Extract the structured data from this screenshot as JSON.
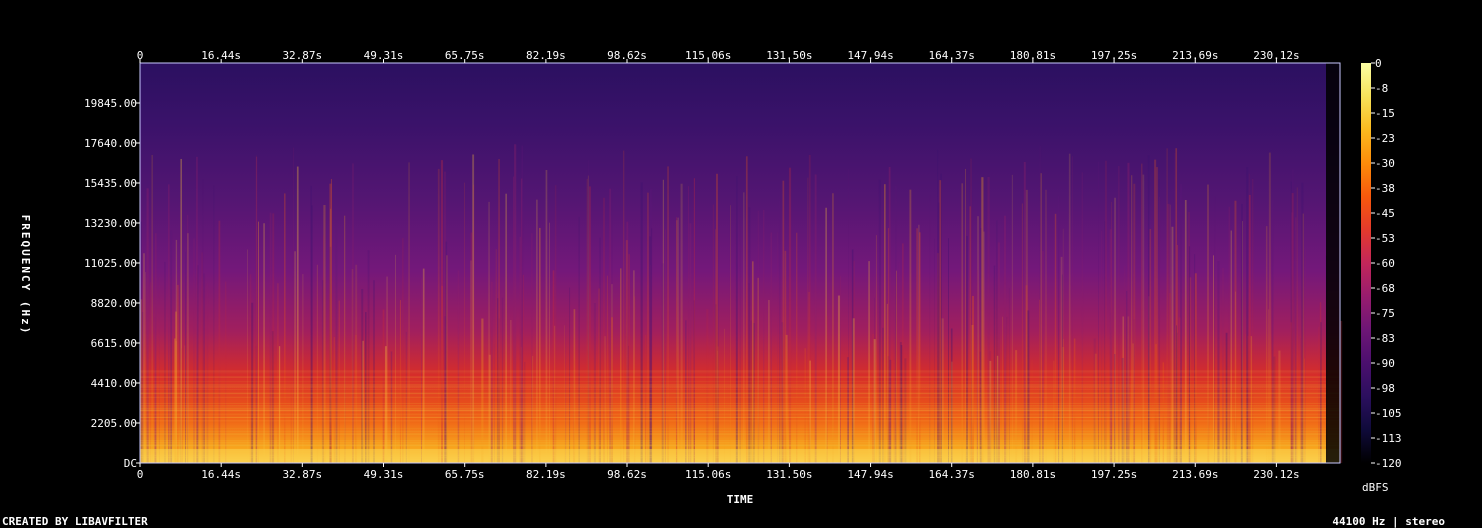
{
  "chart_data": {
    "type": "heatmap",
    "xlabel": "TIME",
    "ylabel": "FREQUENCY (Hz)",
    "x_ticks": [
      "0",
      "16.44s",
      "32.87s",
      "49.31s",
      "65.75s",
      "82.19s",
      "98.62s",
      "115.06s",
      "131.50s",
      "147.94s",
      "164.37s",
      "180.81s",
      "197.25s",
      "213.69s",
      "230.12s"
    ],
    "x_tick_values": [
      0,
      16.44,
      32.87,
      49.31,
      65.75,
      82.19,
      98.62,
      115.06,
      131.5,
      147.94,
      164.37,
      180.81,
      197.25,
      213.69,
      230.12
    ],
    "xlim": [
      0,
      243
    ],
    "y_ticks": [
      "DC",
      "2205.00",
      "4410.00",
      "6615.00",
      "8820.00",
      "11025.00",
      "13230.00",
      "15435.00",
      "17640.00",
      "19845.00"
    ],
    "y_tick_values": [
      0,
      2205,
      4410,
      6615,
      8820,
      11025,
      13230,
      15435,
      17640,
      19845
    ],
    "ylim": [
      0,
      22050
    ],
    "colorbar": {
      "label": "dBFS",
      "ticks": [
        "0",
        "-8",
        "-15",
        "-23",
        "-30",
        "-38",
        "-45",
        "-53",
        "-60",
        "-68",
        "-75",
        "-83",
        "-90",
        "-98",
        "-105",
        "-113",
        "-120"
      ],
      "range": [
        -120,
        0
      ],
      "colors": [
        "#000000",
        "#0f0a3a",
        "#2b0f5e",
        "#4b0f6e",
        "#6e1676",
        "#981c6e",
        "#c3265a",
        "#e43a2c",
        "#f8590c",
        "#fd8c0a",
        "#fbba1f",
        "#f7e25a",
        "#fcffa4"
      ]
    },
    "footer_left": "CREATED BY LIBAVFILTER",
    "footer_right": "44100 Hz | stereo"
  }
}
